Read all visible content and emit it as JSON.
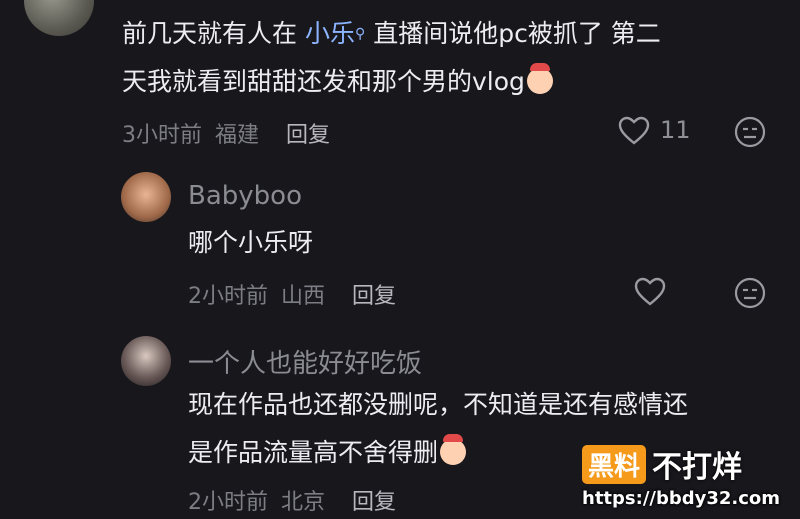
{
  "comments": [
    {
      "text_line1_pre": "前几天就有人在",
      "mention": "小乐",
      "text_line1_post": "直播间说他pc被抓了 第二",
      "text_line2": "天我就看到甜甜还发和那个男的vlog",
      "time": "3小时前",
      "location": "福建",
      "reply": "回复",
      "likes": "11"
    },
    {
      "username": "Babyboo",
      "text": "哪个小乐呀",
      "time": "2小时前",
      "location": "山西",
      "reply": "回复"
    },
    {
      "username": "一个人也能好好吃饭",
      "text_line1": "现在作品也还都没删呢，不知道是还有感情还",
      "text_line2": "是作品流量高不舍得删",
      "time": "2小时前",
      "location": "北京",
      "reply": "回复"
    }
  ],
  "watermark": {
    "brand_box": "黑料",
    "brand_name": "不打烊",
    "url": "https://bbdy32.com"
  },
  "colors": {
    "background": "#17171c",
    "mention": "#8cb4ff",
    "watermark_accent": "#f59a1b"
  }
}
